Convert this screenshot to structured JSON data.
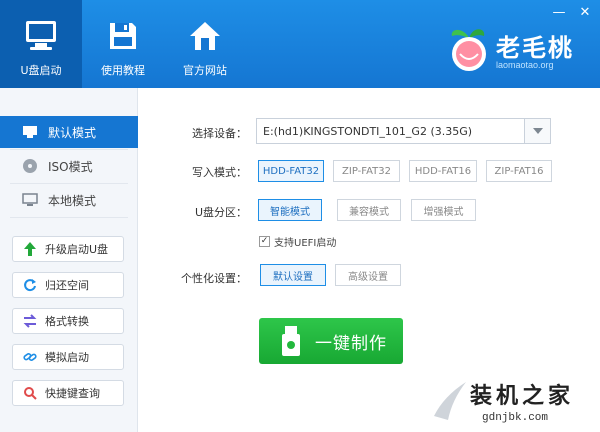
{
  "nav": {
    "usb_boot": "U盘启动",
    "tutorial": "使用教程",
    "website": "官方网站"
  },
  "window": {
    "minimize": "—",
    "close": "✕"
  },
  "logo": {
    "name": "老毛桃",
    "url": "laomaotao.org"
  },
  "sidebar": {
    "modes": [
      {
        "label": "默认模式",
        "icon": "usb-drive-icon",
        "active": true
      },
      {
        "label": "ISO模式",
        "icon": "disc-icon",
        "active": false
      },
      {
        "label": "本地模式",
        "icon": "monitor-icon",
        "active": false
      }
    ],
    "tools": [
      {
        "label": "升级启动U盘",
        "icon": "upgrade-arrow-icon"
      },
      {
        "label": "归还空间",
        "icon": "refresh-icon"
      },
      {
        "label": "格式转换",
        "icon": "convert-icon"
      },
      {
        "label": "模拟启动",
        "icon": "link-icon"
      },
      {
        "label": "快捷键查询",
        "icon": "search-icon"
      }
    ]
  },
  "main": {
    "device_label": "选择设备：",
    "device_value": "E:(hd1)KINGSTONDTI_101_G2 (3.35G)",
    "write_mode_label": "写入模式：",
    "write_modes": [
      "HDD-FAT32",
      "ZIP-FAT32",
      "HDD-FAT16",
      "ZIP-FAT16"
    ],
    "write_mode_selected": "HDD-FAT32",
    "partition_label": "U盘分区：",
    "partitions": [
      "智能模式",
      "兼容模式",
      "增强模式"
    ],
    "partition_selected": "智能模式",
    "uefi_label": "支持UEFI启动",
    "uefi_checked": true,
    "personalize_label": "个性化设置：",
    "personalize": [
      "默认设置",
      "高级设置"
    ],
    "personalize_selected": "默认设置",
    "make_button": "一键制作"
  },
  "watermark": {
    "text": "装机之家",
    "url": "gdnjbk.com"
  },
  "colors": {
    "header": "#1576d2",
    "active": "#1576d2",
    "make": "#22b83d"
  }
}
